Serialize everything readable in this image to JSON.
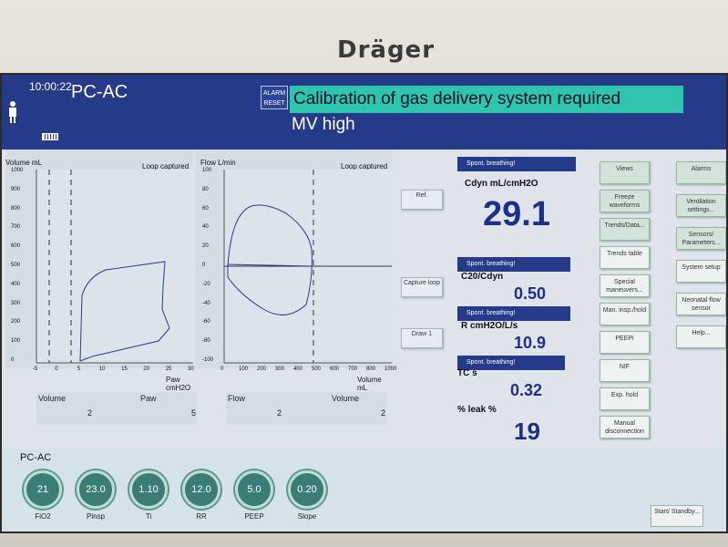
{
  "device": {
    "brand": "Dräger"
  },
  "header": {
    "time": "10:00:22",
    "mode": "PC-AC",
    "alarm_reset_label": "ALARM RESET",
    "alarm_high": "Calibration of gas delivery system required",
    "alarm_low": "MV high"
  },
  "loop1": {
    "y_label": "Volume mL",
    "x_label": "Paw cmH2O",
    "status": "Loop captured",
    "y_ticks": [
      "1000",
      "900",
      "800",
      "700",
      "600",
      "500",
      "400",
      "300",
      "200",
      "100",
      "0"
    ],
    "x_ticks": [
      "-5",
      "0",
      "5",
      "10",
      "15",
      "20",
      "25",
      "30"
    ]
  },
  "loop2": {
    "y_label": "Flow L/min",
    "x_label": "Volume mL",
    "status": "Loop captured",
    "y_ticks": [
      "100",
      "80",
      "60",
      "40",
      "20",
      "0",
      "-20",
      "-40",
      "-60",
      "-80",
      "-100"
    ],
    "x_ticks": [
      "0",
      "100",
      "200",
      "300",
      "400",
      "500",
      "600",
      "700",
      "800",
      "1000"
    ]
  },
  "loop_buttons": {
    "ref": "Ref.",
    "capture": "Capture loop",
    "draw": "Draw 1"
  },
  "loop_values": {
    "left": [
      {
        "label": "Volume",
        "value": "2"
      },
      {
        "label": "Paw",
        "value": "5"
      }
    ],
    "right": [
      {
        "label": "Flow",
        "value": "2"
      },
      {
        "label": "Volume",
        "value": "2"
      }
    ]
  },
  "params": {
    "head1": "Spont. breathing!",
    "cdyn_name": "Cdyn mL/cmH2O",
    "cdyn_value": "29.1",
    "head2": "Spont. breathing!",
    "c20_name": "C20/Cdyn",
    "c20_value": "0.50",
    "head3": "Spont. breathing!",
    "r_name": "R cmH2O/L/s",
    "r_value": "10.9",
    "head4": "Spont. breathing!",
    "tc_name": "TC s",
    "tc_value": "0.32",
    "leak_name": "% leak %",
    "leak_value": "19"
  },
  "menu_col1": [
    "Views",
    "Freeze waveforms",
    "Trends/Data...",
    "Trends table",
    "Special maneuvers...",
    "Man. insp./hold",
    "PEEPi",
    "NIF",
    "Exp. hold",
    "Manual disconnection"
  ],
  "menu_col2": [
    "Alarms",
    "Ventilation settings...",
    "Sensors/ Parameters...",
    "System setup",
    "Neonatal flow sensor",
    "Help..."
  ],
  "bottom": {
    "mode": "PC-AC",
    "knobs": [
      {
        "value": "21",
        "label": "FiO2"
      },
      {
        "value": "23.0",
        "label": "Pinsp"
      },
      {
        "value": "1.10",
        "label": "Ti"
      },
      {
        "value": "12.0",
        "label": "RR"
      },
      {
        "value": "5.0",
        "label": "PEEP"
      },
      {
        "value": "0.20",
        "label": "Slope"
      }
    ],
    "standby": "Start/ Standby..."
  },
  "colors": {
    "header": "#263a8a",
    "alarm_high": "#2ec4ad",
    "knob": "#3a7d76",
    "value": "#1d2f8a"
  }
}
